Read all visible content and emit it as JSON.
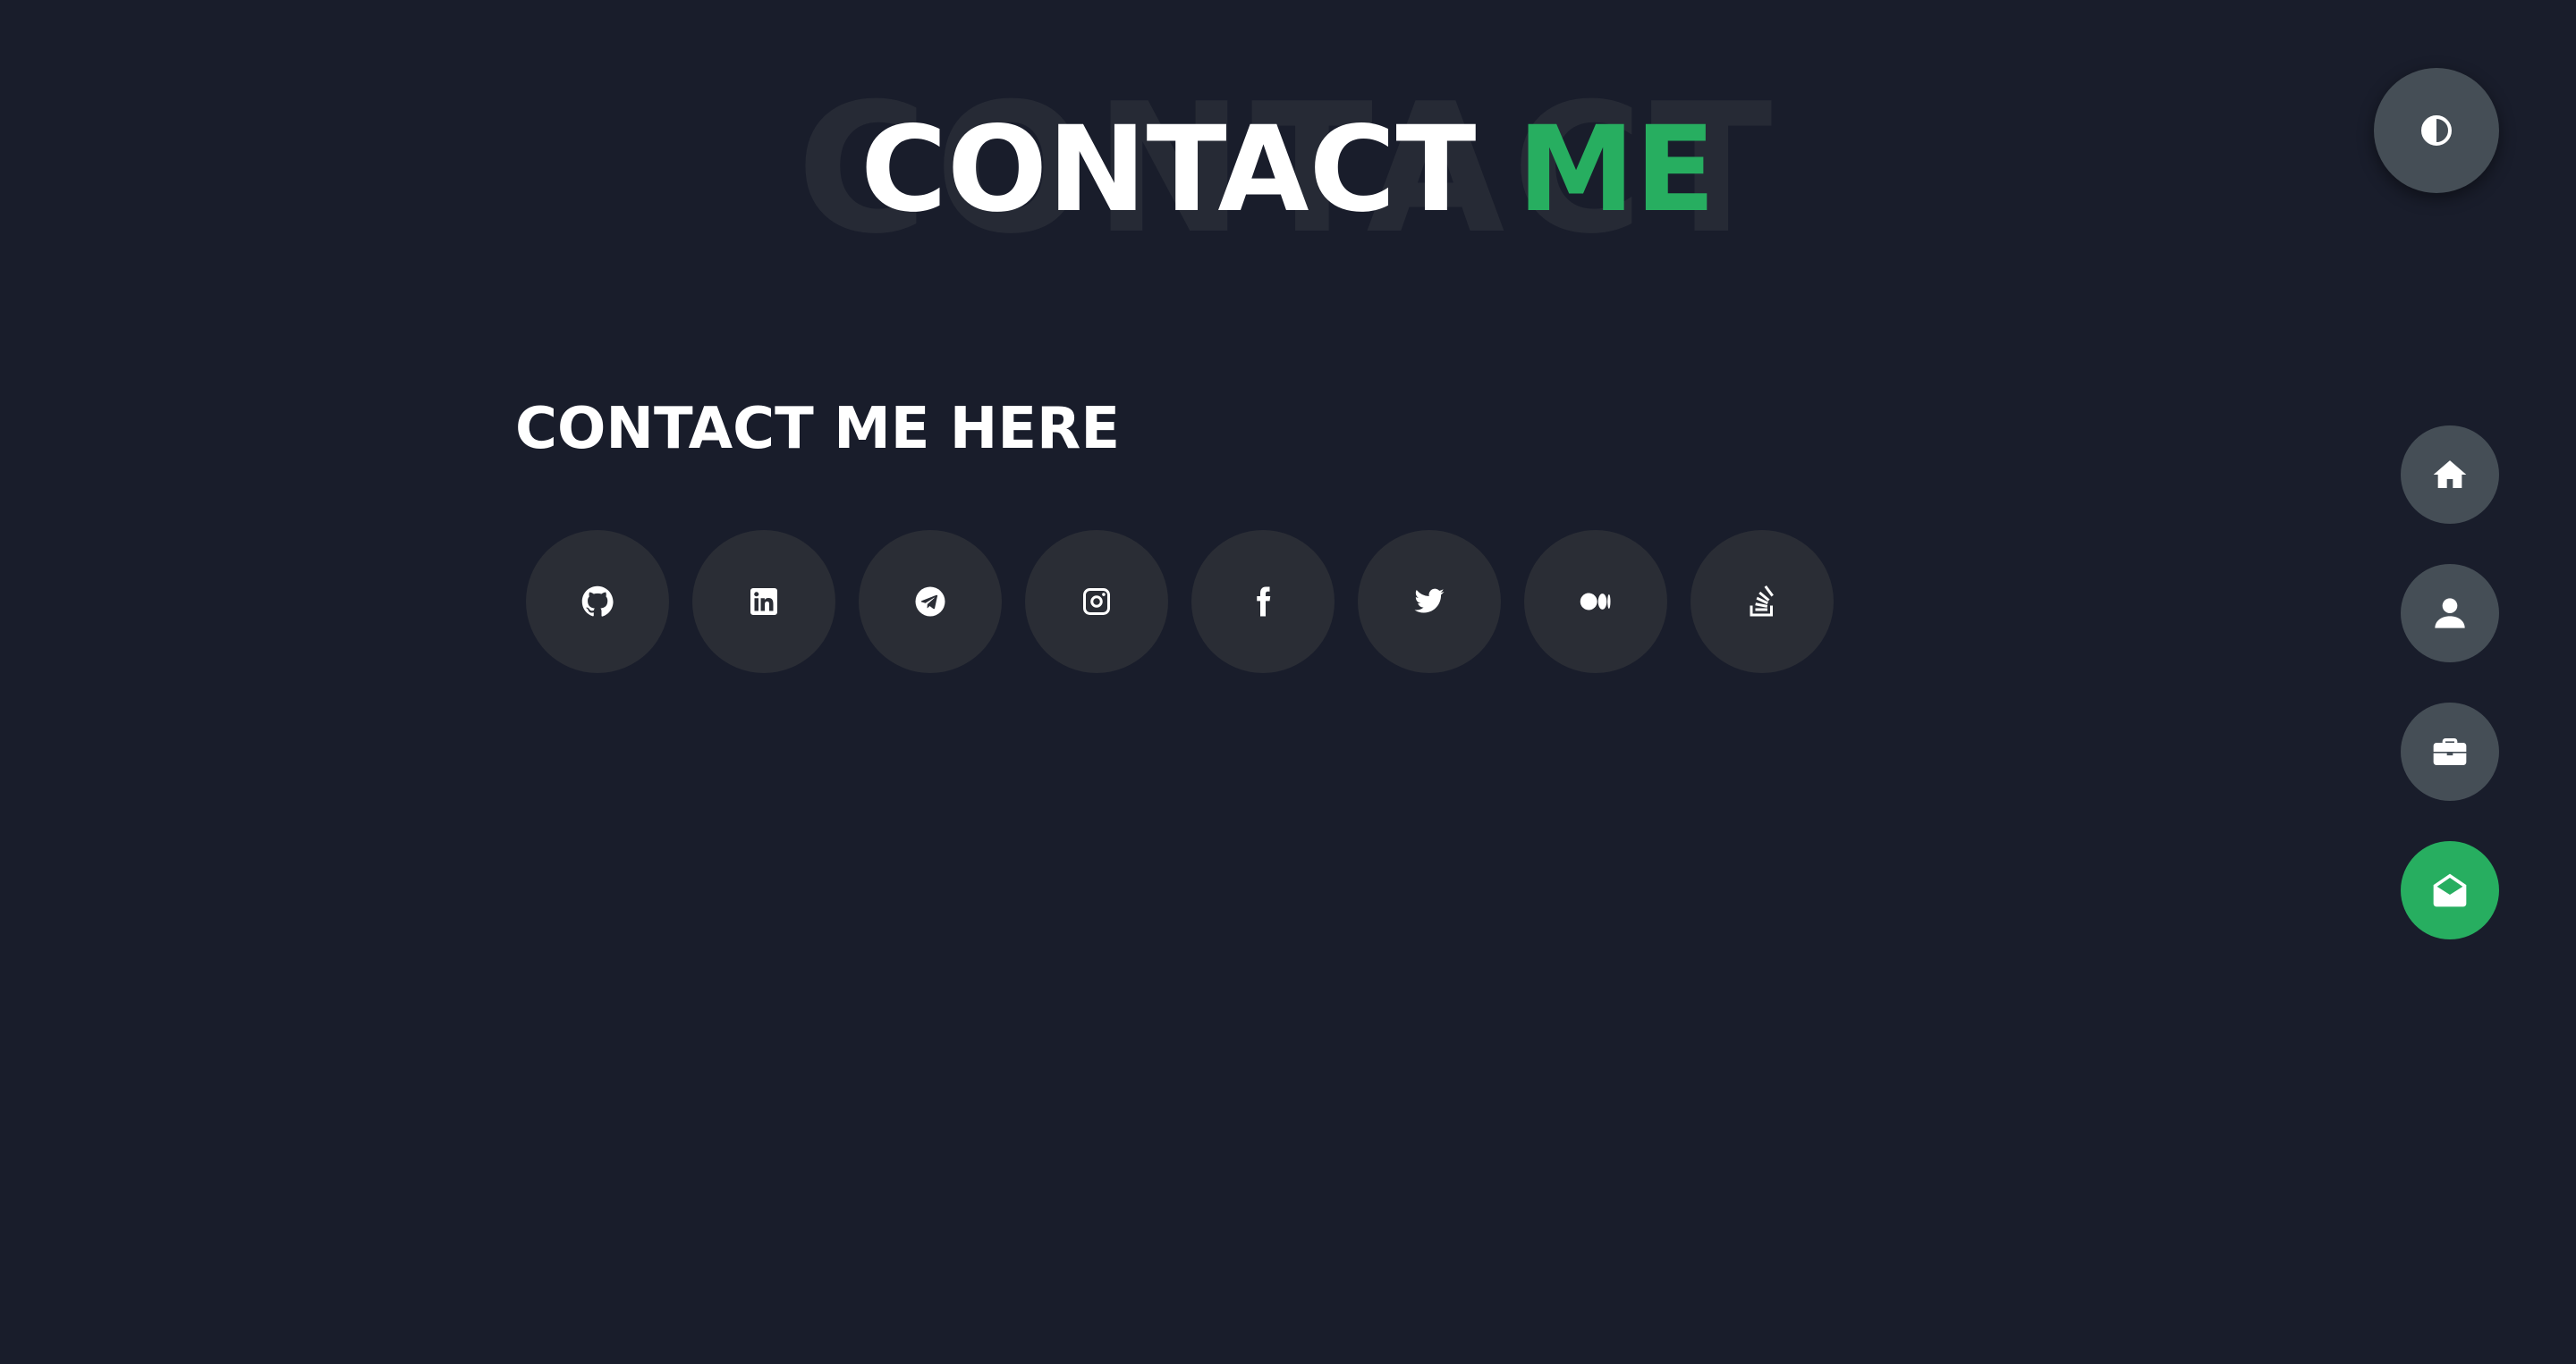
{
  "heading": {
    "background_text": "CONTACT",
    "main_text": "CONTACT",
    "accent_text": "ME"
  },
  "contact": {
    "title": "CONTACT ME HERE",
    "socials": [
      {
        "name": "github",
        "icon": "github-icon"
      },
      {
        "name": "linkedin",
        "icon": "linkedin-icon"
      },
      {
        "name": "telegram",
        "icon": "telegram-icon"
      },
      {
        "name": "instagram",
        "icon": "instagram-icon"
      },
      {
        "name": "facebook",
        "icon": "facebook-icon"
      },
      {
        "name": "twitter",
        "icon": "twitter-icon"
      },
      {
        "name": "medium",
        "icon": "medium-icon"
      },
      {
        "name": "stackoverflow",
        "icon": "stackoverflow-icon"
      }
    ]
  },
  "theme_toggle": {
    "icon": "contrast-icon"
  },
  "nav": {
    "items": [
      {
        "name": "home",
        "icon": "home-icon",
        "active": false
      },
      {
        "name": "about",
        "icon": "user-icon",
        "active": false
      },
      {
        "name": "portfolio",
        "icon": "briefcase-icon",
        "active": false
      },
      {
        "name": "contact",
        "icon": "envelope-open-icon",
        "active": true
      }
    ]
  },
  "colors": {
    "background": "#191d2b",
    "accent": "#27ae60",
    "button": "#454e56",
    "social_bg": "#2a2d35"
  }
}
